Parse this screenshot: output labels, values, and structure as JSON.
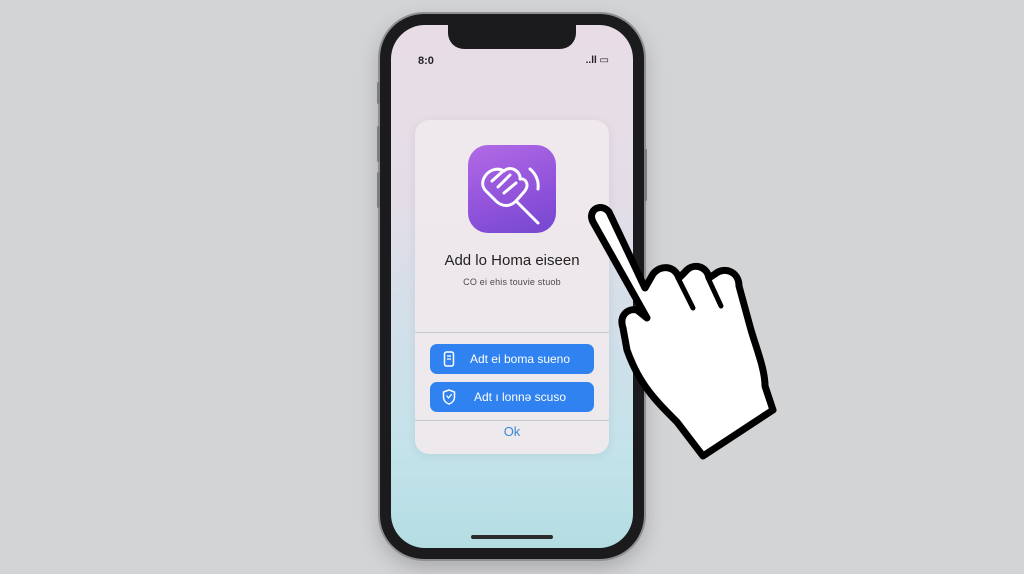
{
  "status_bar": {
    "left_text": "8:0",
    "right_text": "..ll ▭"
  },
  "dialog": {
    "title": "Add lo Homa eiseen",
    "subtitle": "CO ei ehis touvie stuob",
    "buttons": [
      {
        "label": "Adt ei boma sueno",
        "icon": "phone-screen-icon"
      },
      {
        "label": "Adt ı lonnə scuso",
        "icon": "shield-icon"
      }
    ],
    "ok_label": "Ok"
  },
  "app_icon": {
    "icon": "waving-hand-icon",
    "colors": [
      "#b26ae5",
      "#7447cf"
    ]
  },
  "overlay": {
    "icon": "pointing-hand-cursor-icon"
  },
  "colors": {
    "accent": "#2f82ef",
    "ok_text": "#3b88d9",
    "background": "#d3d4d6"
  }
}
